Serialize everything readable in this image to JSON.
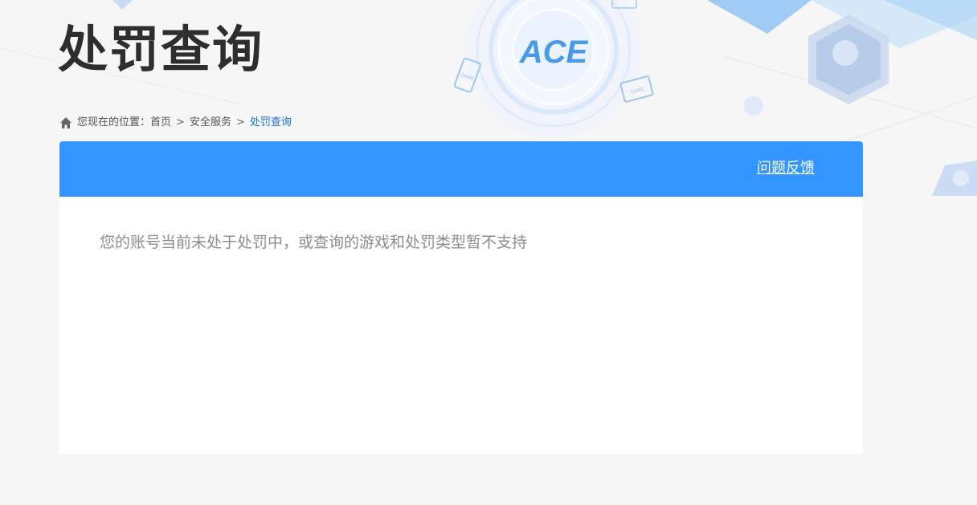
{
  "page": {
    "title": "处罚查询"
  },
  "breadcrumb": {
    "prefix": "您现在的位置：",
    "items": [
      "首页",
      "安全服务",
      "处罚查询"
    ],
    "separator": ">"
  },
  "panel": {
    "feedback_label": "问题反馈",
    "message": "您的账号当前未处于处罚中，或查询的游戏和处罚类型暂不支持"
  },
  "colors": {
    "header_blue": "#3395ff",
    "breadcrumb_current": "#1a73d9",
    "title": "#2e2e2e"
  }
}
